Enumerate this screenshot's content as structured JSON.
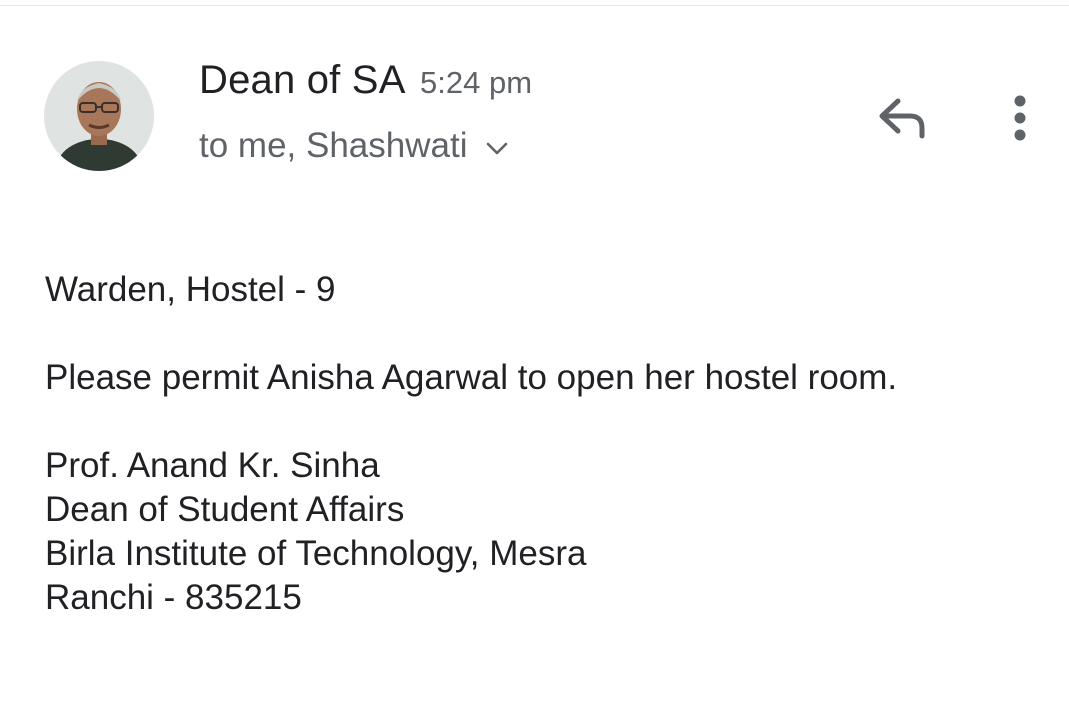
{
  "header": {
    "sender_name": "Dean of SA",
    "time": "5:24 pm",
    "recipients": "to me, Shashwati",
    "icons": {
      "avatar": "sender-avatar",
      "recipients_toggle": "chevron-down-icon",
      "reply": "reply-icon",
      "more": "more-vert-icon"
    }
  },
  "message": {
    "salutation": "Warden, Hostel - 9",
    "body": "Please permit Anisha Agarwal to open her hostel room.",
    "signature": [
      "Prof. Anand Kr. Sinha",
      "Dean of Student Affairs",
      "Birla Institute of Technology, Mesra",
      "Ranchi - 835215"
    ]
  },
  "colors": {
    "primary_text": "#202124",
    "secondary_text": "#5f6368",
    "icon": "#5f6368"
  }
}
